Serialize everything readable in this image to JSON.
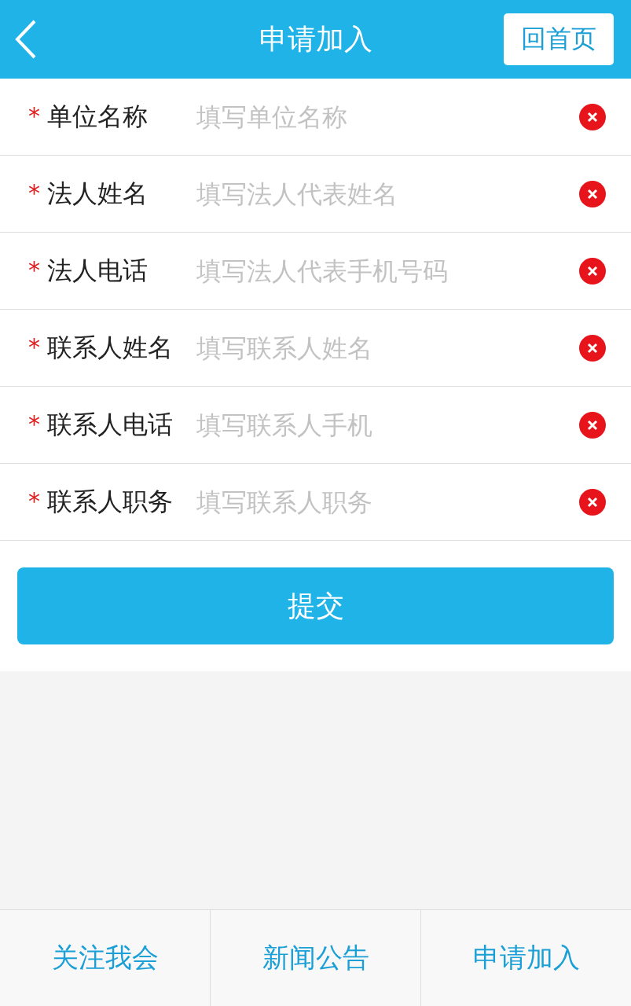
{
  "header": {
    "title": "申请加入",
    "home_button": "回首页"
  },
  "fields": [
    {
      "mark": "*",
      "label": "单位名称",
      "placeholder": "填写单位名称"
    },
    {
      "mark": "*",
      "label": "法人姓名",
      "placeholder": "填写法人代表姓名"
    },
    {
      "mark": "*",
      "label": "法人电话",
      "placeholder": "填写法人代表手机号码"
    },
    {
      "mark": "*",
      "label": "联系人姓名",
      "placeholder": "填写联系人姓名"
    },
    {
      "mark": "*",
      "label": "联系人电话",
      "placeholder": "填写联系人手机"
    },
    {
      "mark": "*",
      "label": "联系人职务",
      "placeholder": "填写联系人职务"
    }
  ],
  "submit_button": "提交",
  "bottom_nav": [
    {
      "label": "关注我会"
    },
    {
      "label": "新闻公告"
    },
    {
      "label": "申请加入"
    }
  ]
}
